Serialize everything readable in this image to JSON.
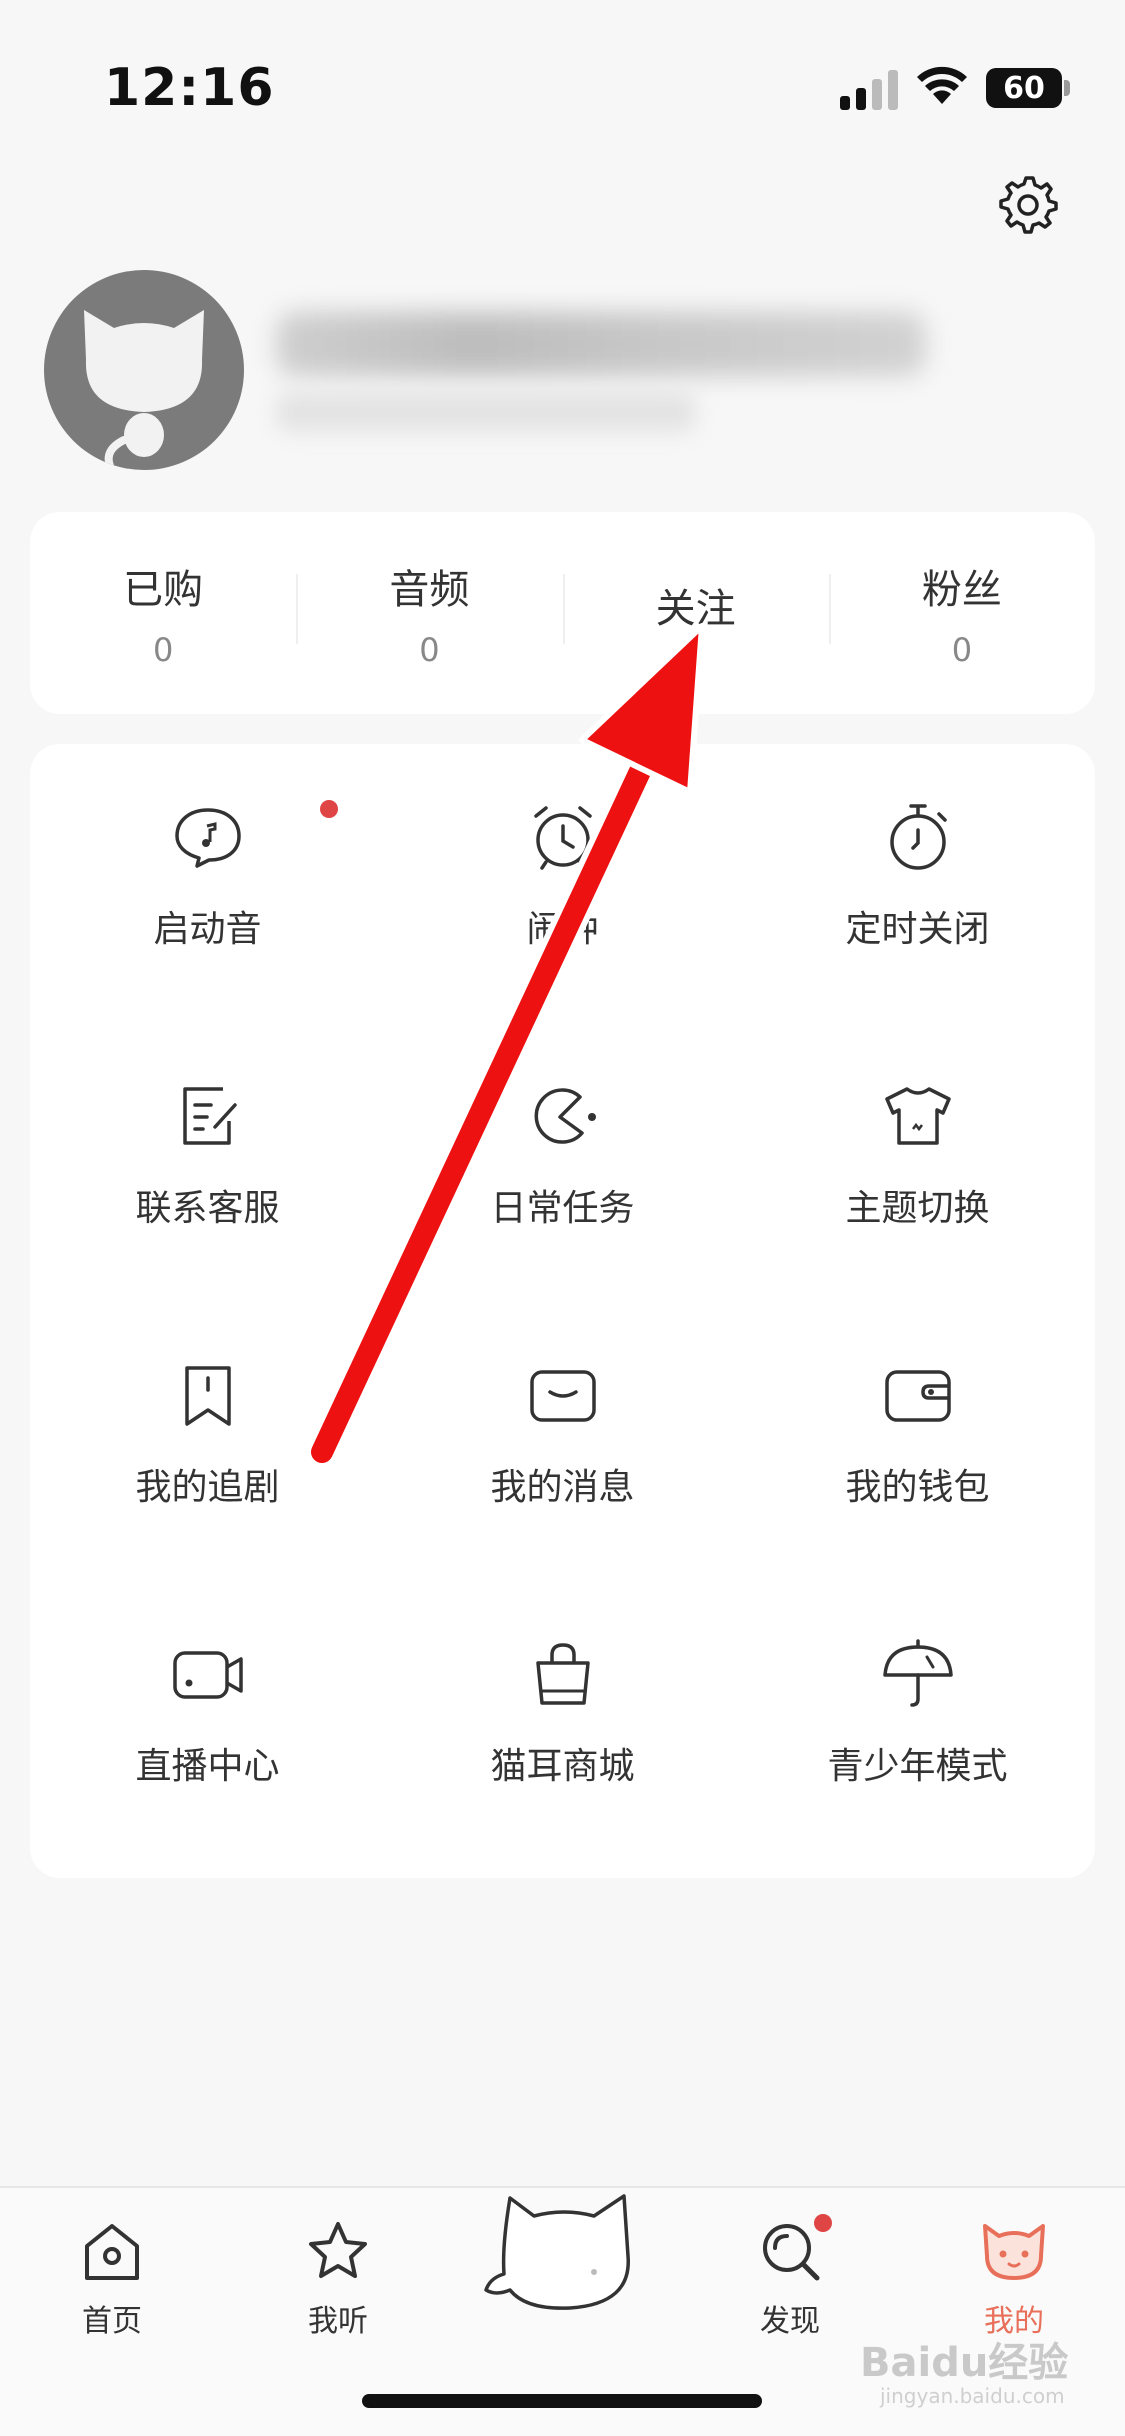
{
  "status_bar": {
    "time": "12:16",
    "battery": "60"
  },
  "stats": [
    {
      "label": "已购",
      "value": "0"
    },
    {
      "label": "音频",
      "value": "0"
    },
    {
      "label": "关注",
      "value": ""
    },
    {
      "label": "粉丝",
      "value": "0"
    }
  ],
  "grid": [
    {
      "label": "启动音",
      "icon": "music-bubble-icon"
    },
    {
      "label": "闹钟",
      "icon": "alarm-clock-icon"
    },
    {
      "label": "定时关闭",
      "icon": "timer-icon"
    },
    {
      "label": "联系客服",
      "icon": "edit-note-icon"
    },
    {
      "label": "日常任务",
      "icon": "pacman-icon"
    },
    {
      "label": "主题切换",
      "icon": "tshirt-icon"
    },
    {
      "label": "我的追剧",
      "icon": "bookmark-icon"
    },
    {
      "label": "我的消息",
      "icon": "mail-icon"
    },
    {
      "label": "我的钱包",
      "icon": "wallet-icon"
    },
    {
      "label": "直播中心",
      "icon": "video-camera-icon"
    },
    {
      "label": "猫耳商城",
      "icon": "shopping-bag-icon"
    },
    {
      "label": "青少年模式",
      "icon": "umbrella-icon"
    }
  ],
  "tabs": [
    {
      "label": "首页",
      "icon": "home-icon"
    },
    {
      "label": "我听",
      "icon": "star-icon"
    },
    {
      "label": "发现",
      "icon": "discover-search-icon"
    },
    {
      "label": "我的",
      "icon": "cat-face-icon"
    }
  ],
  "watermark": {
    "main": "Baidu经验",
    "sub": "jingyan.baidu.com"
  },
  "colors": {
    "accent": "#e8705a",
    "badge": "#e04545",
    "arrow": "#ee1111"
  }
}
